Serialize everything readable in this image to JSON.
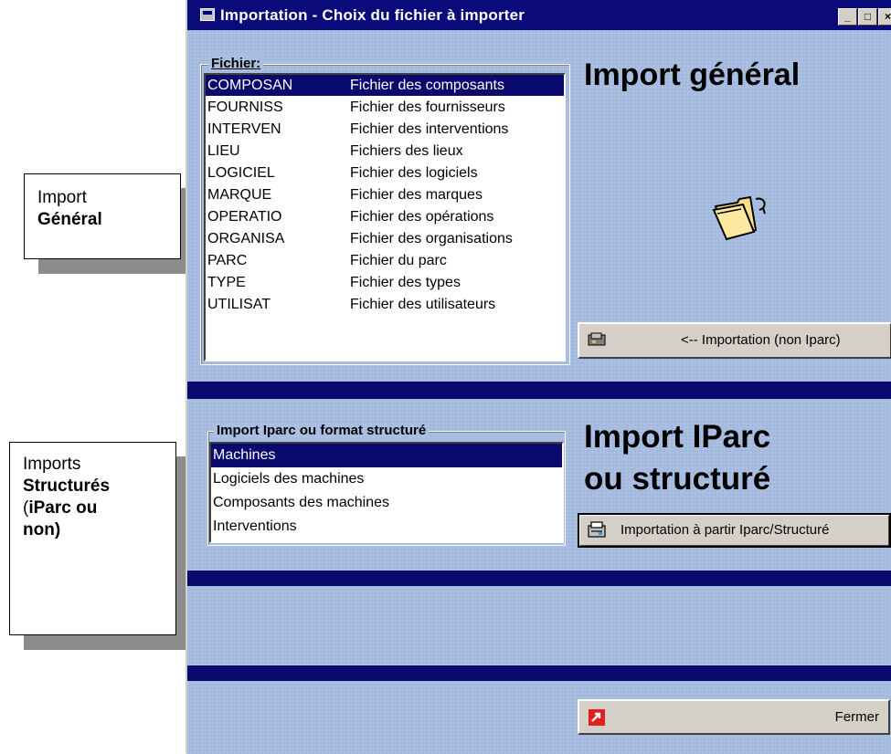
{
  "callouts": {
    "general": {
      "line1": "Import",
      "line2": "Général"
    },
    "structured": {
      "line1": "Imports",
      "line2": "Structurés",
      "line3_prefix": "(",
      "line3_bold": "iParc ou",
      "line4": "non)"
    }
  },
  "window": {
    "title": "Importation - Choix du fichier à importer",
    "minimize_label": "_",
    "maximize_label": "□",
    "close_label": "×"
  },
  "fichier": {
    "label": "Fichier:",
    "items": [
      {
        "code": "COMPOSAN",
        "desc": "Fichier des composants"
      },
      {
        "code": "FOURNISS",
        "desc": "Fichier des fournisseurs"
      },
      {
        "code": "INTERVEN",
        "desc": "Fichier des interventions"
      },
      {
        "code": "LIEU",
        "desc": "Fichiers des lieux"
      },
      {
        "code": "LOGICIEL",
        "desc": "Fichier des logiciels"
      },
      {
        "code": "MARQUE",
        "desc": "Fichier des marques"
      },
      {
        "code": "OPERATIO",
        "desc": "Fichier des opérations"
      },
      {
        "code": "ORGANISA",
        "desc": "Fichier des organisations"
      },
      {
        "code": "PARC",
        "desc": "Fichier du parc"
      },
      {
        "code": "TYPE",
        "desc": "Fichier des types"
      },
      {
        "code": "UTILISAT",
        "desc": "Fichier des utilisateurs"
      }
    ]
  },
  "import_general": {
    "heading": "Import général",
    "button_label": "<-- Importation (non Iparc)",
    "folder_icon": "open-folder-icon"
  },
  "structured": {
    "label": "Import Iparc ou format structuré",
    "items": [
      "Machines",
      "Logiciels des machines",
      "Composants des machines",
      "Interventions"
    ],
    "heading_line1": "Import IParc",
    "heading_line2": "ou structuré",
    "button_label": "Importation à partir Iparc/Structuré"
  },
  "close_button": {
    "label": "Fermer"
  },
  "colors": {
    "title_bar": "#0a0a7a",
    "background": "#a9bee0",
    "selection": "#0a0a6e"
  }
}
